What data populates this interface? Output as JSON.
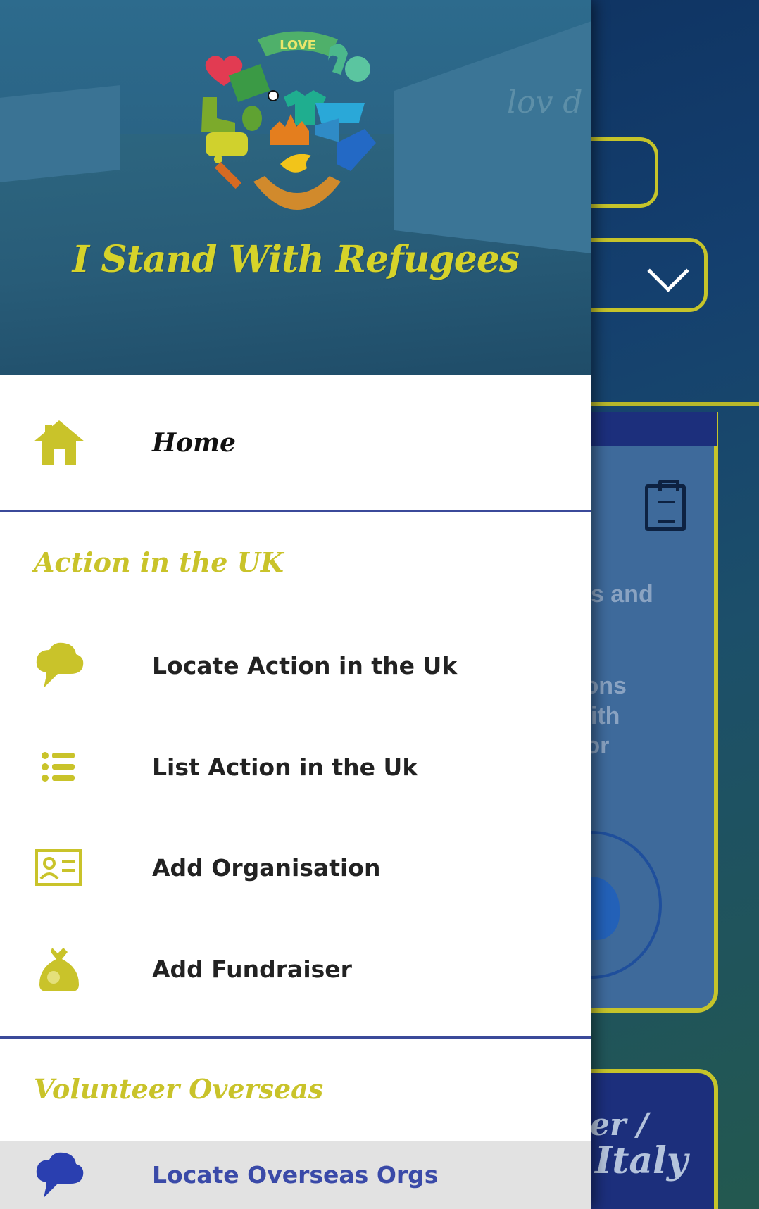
{
  "background": {
    "partial_texts": [
      "es and",
      "ions",
      "vith",
      "for"
    ],
    "italy_card_line1": "er /",
    "italy_card_line2": "Italy"
  },
  "drawer": {
    "header": {
      "logo_text": "LOVE",
      "title": "I Stand With Refugees"
    },
    "home": {
      "label": "Home",
      "icon": "home-icon"
    },
    "sections": [
      {
        "title": "Action in the UK",
        "items": [
          {
            "label": "Locate Action in the Uk",
            "icon": "cloud-pin-icon"
          },
          {
            "label": "List Action in the Uk",
            "icon": "list-icon"
          },
          {
            "label": "Add Organisation",
            "icon": "id-card-icon"
          },
          {
            "label": "Add Fundraiser",
            "icon": "money-bag-icon"
          }
        ]
      },
      {
        "title": "Volunteer Overseas",
        "items": [
          {
            "label": "Locate Overseas Orgs",
            "icon": "cloud-pin-icon"
          }
        ]
      }
    ]
  },
  "colors": {
    "accent_yellow": "#c9c32a",
    "divider_blue": "#3b4a9a",
    "selected_text": "#3a4aa8",
    "selected_icon": "#2a3fb0",
    "header_bg": "#2a6384"
  }
}
